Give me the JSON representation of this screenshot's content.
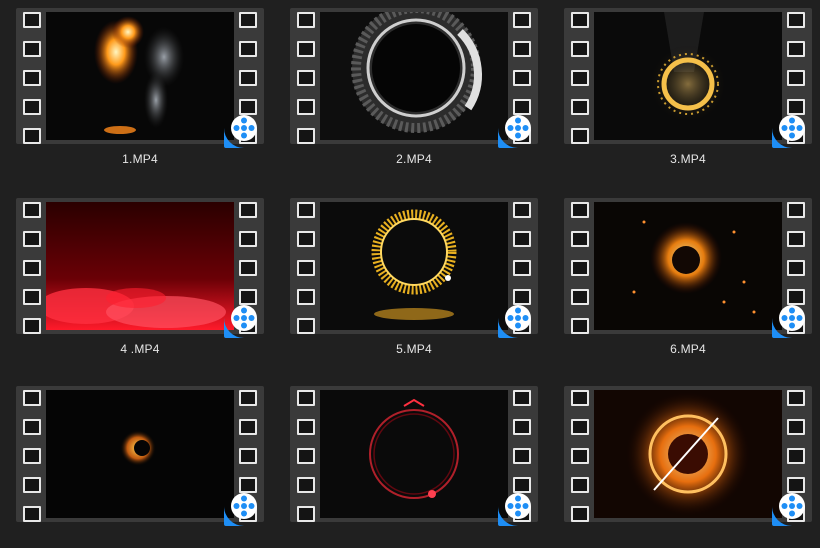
{
  "files": [
    {
      "name": "1.MP4",
      "icon": "film-strip-icon"
    },
    {
      "name": "2.MP4",
      "icon": "film-strip-icon"
    },
    {
      "name": "3.MP4",
      "icon": "film-strip-icon"
    },
    {
      "name": "4 .MP4",
      "icon": "film-strip-icon"
    },
    {
      "name": "5.MP4",
      "icon": "film-strip-icon"
    },
    {
      "name": "6.MP4",
      "icon": "film-strip-icon"
    },
    {
      "name": "",
      "icon": "film-strip-icon"
    },
    {
      "name": "",
      "icon": "film-strip-icon"
    },
    {
      "name": "",
      "icon": "film-strip-icon"
    }
  ],
  "app_icon": "video-player-app-icon",
  "colors": {
    "background": "#202020",
    "film_strip": "#3a3a3a",
    "badge": "#1e8ef5",
    "caption": "#e6e6e6"
  }
}
